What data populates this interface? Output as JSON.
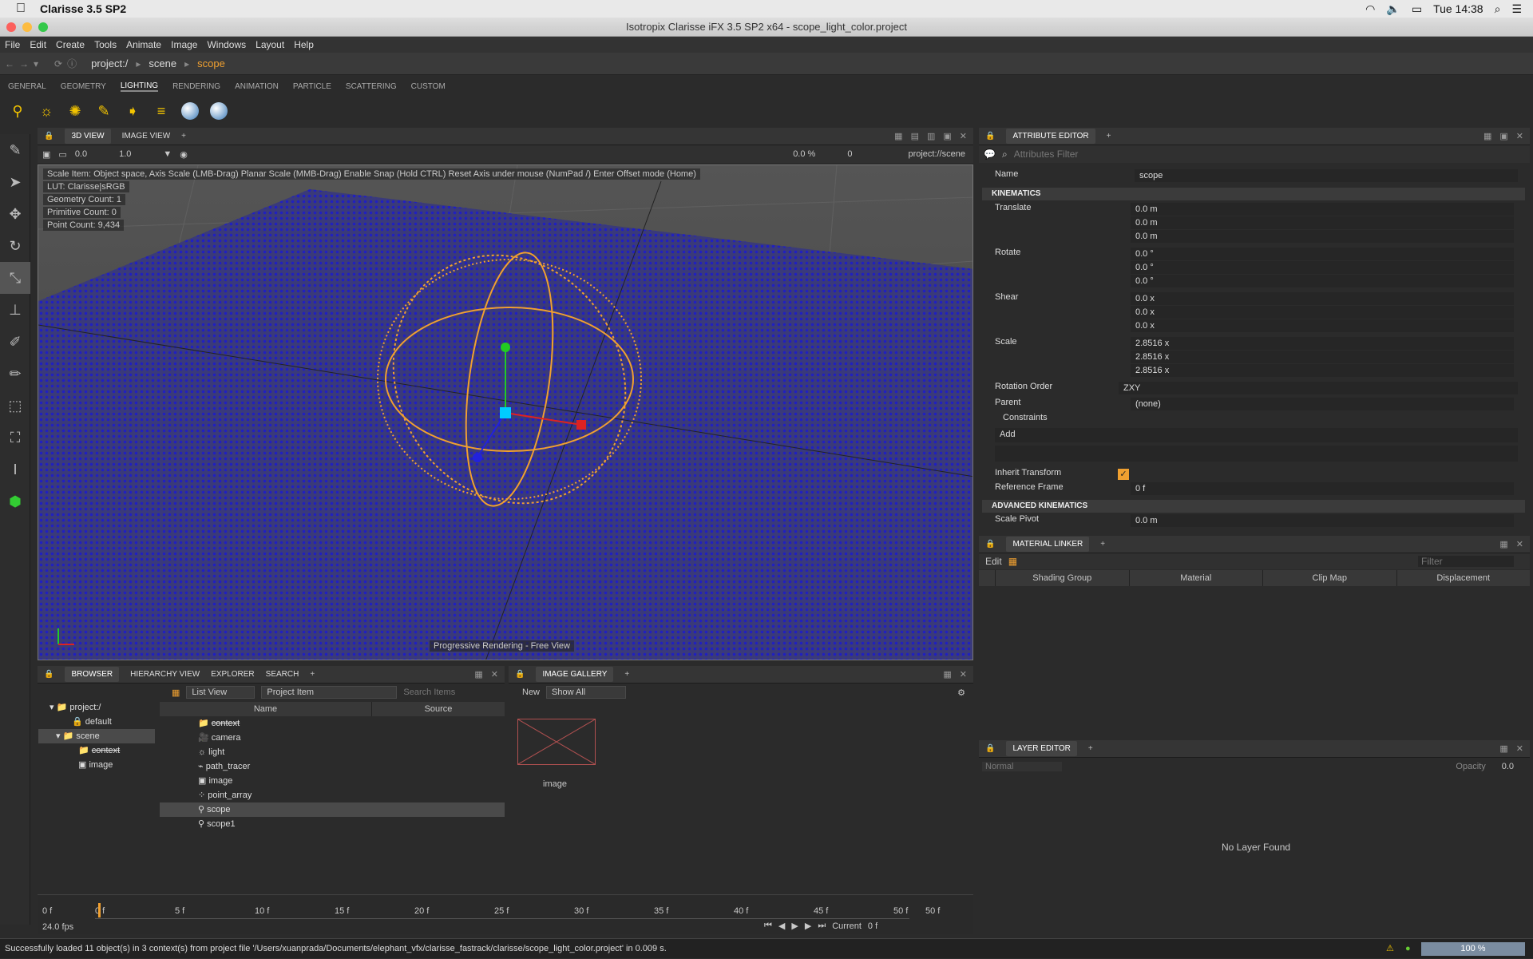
{
  "mac": {
    "app_name": "Clarisse 3.5 SP2",
    "clock": "Tue 14:38"
  },
  "window_title": "Isotropix Clarisse iFX 3.5 SP2 x64  - scope_light_color.project",
  "menu": [
    "File",
    "Edit",
    "Create",
    "Tools",
    "Animate",
    "Image",
    "Windows",
    "Layout",
    "Help"
  ],
  "path": [
    "project:/",
    "scene",
    "scope"
  ],
  "shelf_tabs": [
    "GENERAL",
    "GEOMETRY",
    "LIGHTING",
    "RENDERING",
    "ANIMATION",
    "PARTICLE",
    "SCATTERING",
    "CUSTOM"
  ],
  "shelf_icons": [
    "add-light-icon",
    "sun-icon",
    "bulb-icon",
    "spot-icon",
    "directional-icon",
    "area-light-icon",
    "sphere-light-icon",
    "dome-light-icon"
  ],
  "viewport": {
    "tabs": [
      "3D VIEW",
      "IMAGE VIEW"
    ],
    "toolbar_vals": {
      "near": "0.0",
      "scale": "1.0",
      "pct": "0.0 %",
      "frame": "0",
      "context": "project://scene"
    },
    "hint": "Scale Item: Object space, Axis Scale (LMB-Drag)  Planar Scale (MMB-Drag)  Enable Snap (Hold CTRL)  Reset Axis under mouse (NumPad /)  Enter Offset mode (Home)",
    "lut": "LUT: Clarisse|sRGB",
    "geometry_count": "Geometry Count: 1",
    "primitive_count": "Primitive Count: 0",
    "point_count": "Point Count: 9,434",
    "render_label": "Progressive Rendering - Free View"
  },
  "attr": {
    "title": "ATTRIBUTE EDITOR",
    "filter_placeholder": "Attributes Filter",
    "name_label": "Name",
    "name_value": "scope",
    "kinematics": "KINEMATICS",
    "translate": "Translate",
    "translate_vals": [
      "0.0 m",
      "0.0 m",
      "0.0 m"
    ],
    "rotate": "Rotate",
    "rotate_vals": [
      "0.0 °",
      "0.0 °",
      "0.0 °"
    ],
    "shear": "Shear",
    "shear_vals": [
      "0.0 x",
      "0.0 x",
      "0.0 x"
    ],
    "scale": "Scale",
    "scale_vals": [
      "2.8516 x",
      "2.8516 x",
      "2.8516 x"
    ],
    "rotation_order_label": "Rotation Order",
    "rotation_order": "ZXY",
    "parent_label": "Parent",
    "parent": "(none)",
    "constraints": "Constraints",
    "add": "Add",
    "inherit_label": "Inherit Transform",
    "ref_frame_label": "Reference Frame",
    "ref_frame": "0 f",
    "adv": "ADVANCED KINEMATICS",
    "scale_pivot": "Scale Pivot",
    "scale_pivot_val": "0.0 m"
  },
  "material": {
    "title": "MATERIAL LINKER",
    "edit": "Edit",
    "filter": "Filter",
    "columns": [
      "Shading Group",
      "Material",
      "Clip Map",
      "Displacement"
    ]
  },
  "layer": {
    "title": "LAYER EDITOR",
    "mode": "Normal",
    "opacity_label": "Opacity",
    "opacity": "0.0",
    "empty": "No Layer Found"
  },
  "browser": {
    "tabs": [
      "BROWSER",
      "HIERARCHY VIEW",
      "EXPLORER",
      "SEARCH"
    ],
    "view": "List View",
    "filter": "Project Item",
    "search": "Search Items",
    "cols": [
      "Name",
      "Source"
    ],
    "tree": [
      "project:/",
      "default",
      "scene",
      "context",
      "image"
    ],
    "items": [
      "context",
      "camera",
      "light",
      "path_tracer",
      "image",
      "point_array",
      "scope",
      "scope1"
    ]
  },
  "gallery": {
    "title": "IMAGE GALLERY",
    "new": "New",
    "show": "Show All",
    "thumb": "image"
  },
  "timeline": {
    "ticks": [
      "0 f",
      "5 f",
      "10 f",
      "15 f",
      "20 f",
      "25 f",
      "30 f",
      "35 f",
      "40 f",
      "45 f",
      "50 f"
    ],
    "start": "0 f",
    "end": "50 f",
    "fps": "24.0 fps",
    "current_label": "Current",
    "current": "0 f"
  },
  "status": {
    "message": "Successfully loaded 11 object(s) in 3 context(s) from project file '/Users/xuanprada/Documents/elephant_vfx/clarisse_fastrack/clarisse/scope_light_color.project' in 0.009 s.",
    "zoom": "100 %"
  },
  "colors": {
    "accent": "#f0a030",
    "viewport_bg": "#4a4a4a",
    "points": "#2020c0"
  }
}
